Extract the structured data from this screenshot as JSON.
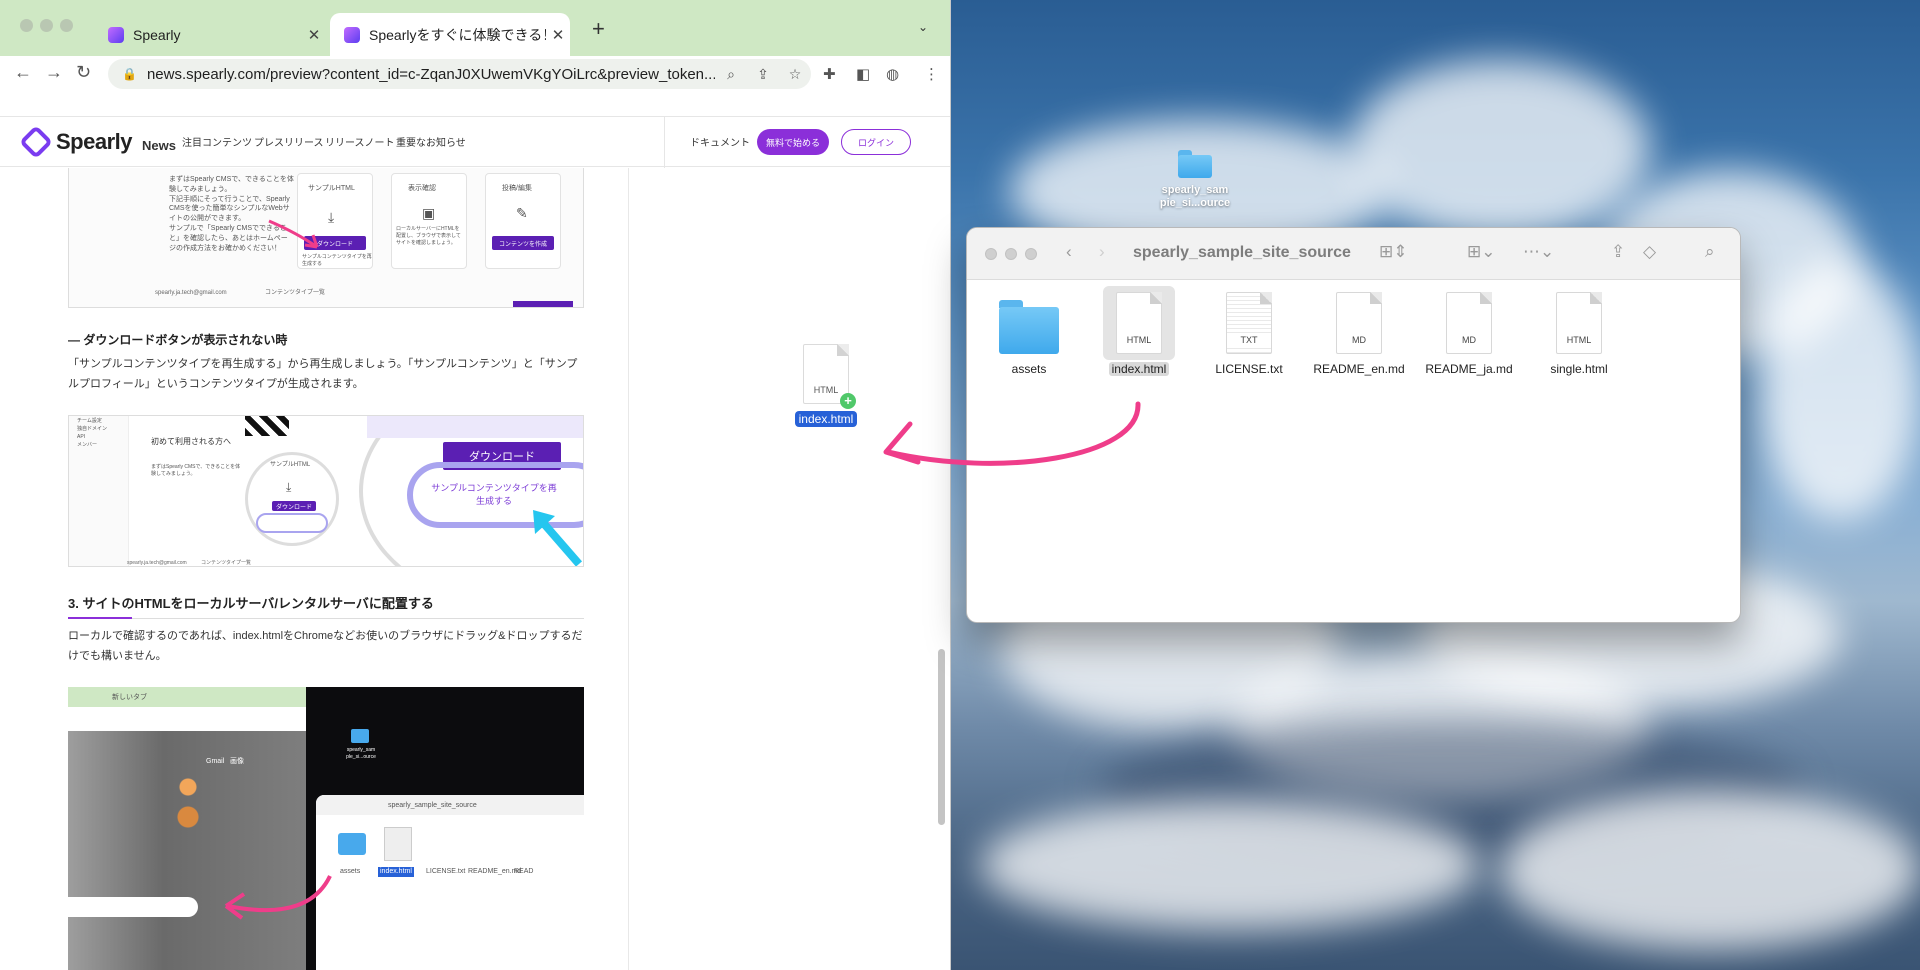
{
  "browser": {
    "tabs": [
      {
        "title": "Spearly",
        "close": "✕"
      },
      {
        "title": "Spearlyをすぐに体験できる！サン",
        "close": "✕"
      }
    ],
    "new_tab": "+",
    "url": "news.spearly.com/preview?content_id=c-ZqanJ0XUwemVKgYOiLrc&preview_token..."
  },
  "site": {
    "logo": "Spearly",
    "logo_sub": "News",
    "nav": [
      "注目コンテンツ",
      "プレスリリース",
      "リリースノート",
      "重要なお知らせ"
    ],
    "doc_link": "ドキュメント",
    "free_button": "無料で始める",
    "login_button": "ログイン"
  },
  "article": {
    "shot1": {
      "cards": [
        "サンプルHTML",
        "表示確認",
        "投稿/編集"
      ],
      "download": "ダウンロード",
      "content_btn": "コンテンツを作成",
      "regen_note": "サンプルコンテンツタイプを再生成する",
      "email": "spearly.ja.tech@gmail.com",
      "tag": "コンテンツタイプ一覧",
      "left_text": "まずはSpearly CMSで、できることを体験してみましょう。\n下記手順にそって行うことで、Spearly CMSを使った簡単なシンプルなWebサイトの公開ができます。\nサンプルで「Spearly CMSでできること」を確認したら、あとはホームページの作成方法をお確かめください！",
      "display_text": "ローカルサーバーにHTMLを配置し、ブラウザで表示してサイトを確認しましょう。"
    },
    "subheading1": "ダウンロードボタンが表示されない時",
    "para1": "「サンプルコンテンツタイプを再生成する」から再生成しましょう。「サンプルコンテンツ」と「サンプルプロフィール」というコンテンツタイプが生成されます。",
    "shot2": {
      "heading": "初めて利用される方へ",
      "download": "ダウンロード",
      "regen": "サンプルコンテンツタイプを再生成する",
      "card": "サンプルHTML",
      "sidebar": [
        "チーム設定",
        "独自ドメイン",
        "API",
        "メンバー"
      ],
      "intro": "まずはSpearly CMSで、できることを体験してみましょう。",
      "email": "spearly.ja.tech@gmail.com",
      "tag": "コンテンツタイプ一覧"
    },
    "heading2": "3. サイトのHTMLをローカルサーバ/レンタルサーバに配置する",
    "para2": "ローカルで確認するのであれば、index.htmlをChromeなどお使いのブラウザにドラッグ&ドロップするだけでも構いません。",
    "shot3": {
      "tab": "新しいタブ",
      "gmail": "Gmail",
      "images": "画像",
      "desk_folder": "spearly_sample_site_source",
      "folder_label": "spearly_sam ple_si...ource",
      "finder_title": "spearly_sample_site_source",
      "files": [
        "assets",
        "index.html",
        "LICENSE.txt",
        "README_en.md",
        "README_ja.md"
      ]
    }
  },
  "desktop": {
    "folder_label": "spearly_sample_site_source",
    "folder_label_display": "spearly_sam\npie_si...ource",
    "dragged_file": "index.html",
    "dragged_type": "HTML"
  },
  "finder": {
    "title": "spearly_sample_site_source",
    "items": [
      {
        "name": "assets",
        "kind": "folder",
        "type": ""
      },
      {
        "name": "index.html",
        "kind": "file",
        "type": "HTML",
        "selected": true
      },
      {
        "name": "LICENSE.txt",
        "kind": "file",
        "type": "TXT"
      },
      {
        "name": "README_en.md",
        "kind": "file",
        "type": "MD"
      },
      {
        "name": "README_ja.md",
        "kind": "file",
        "type": "MD"
      },
      {
        "name": "single.html",
        "kind": "file",
        "type": "HTML"
      }
    ]
  },
  "colors": {
    "brand": "#8b2fd9",
    "annotation": "#ef3d8a",
    "selection": "#2761d7"
  }
}
